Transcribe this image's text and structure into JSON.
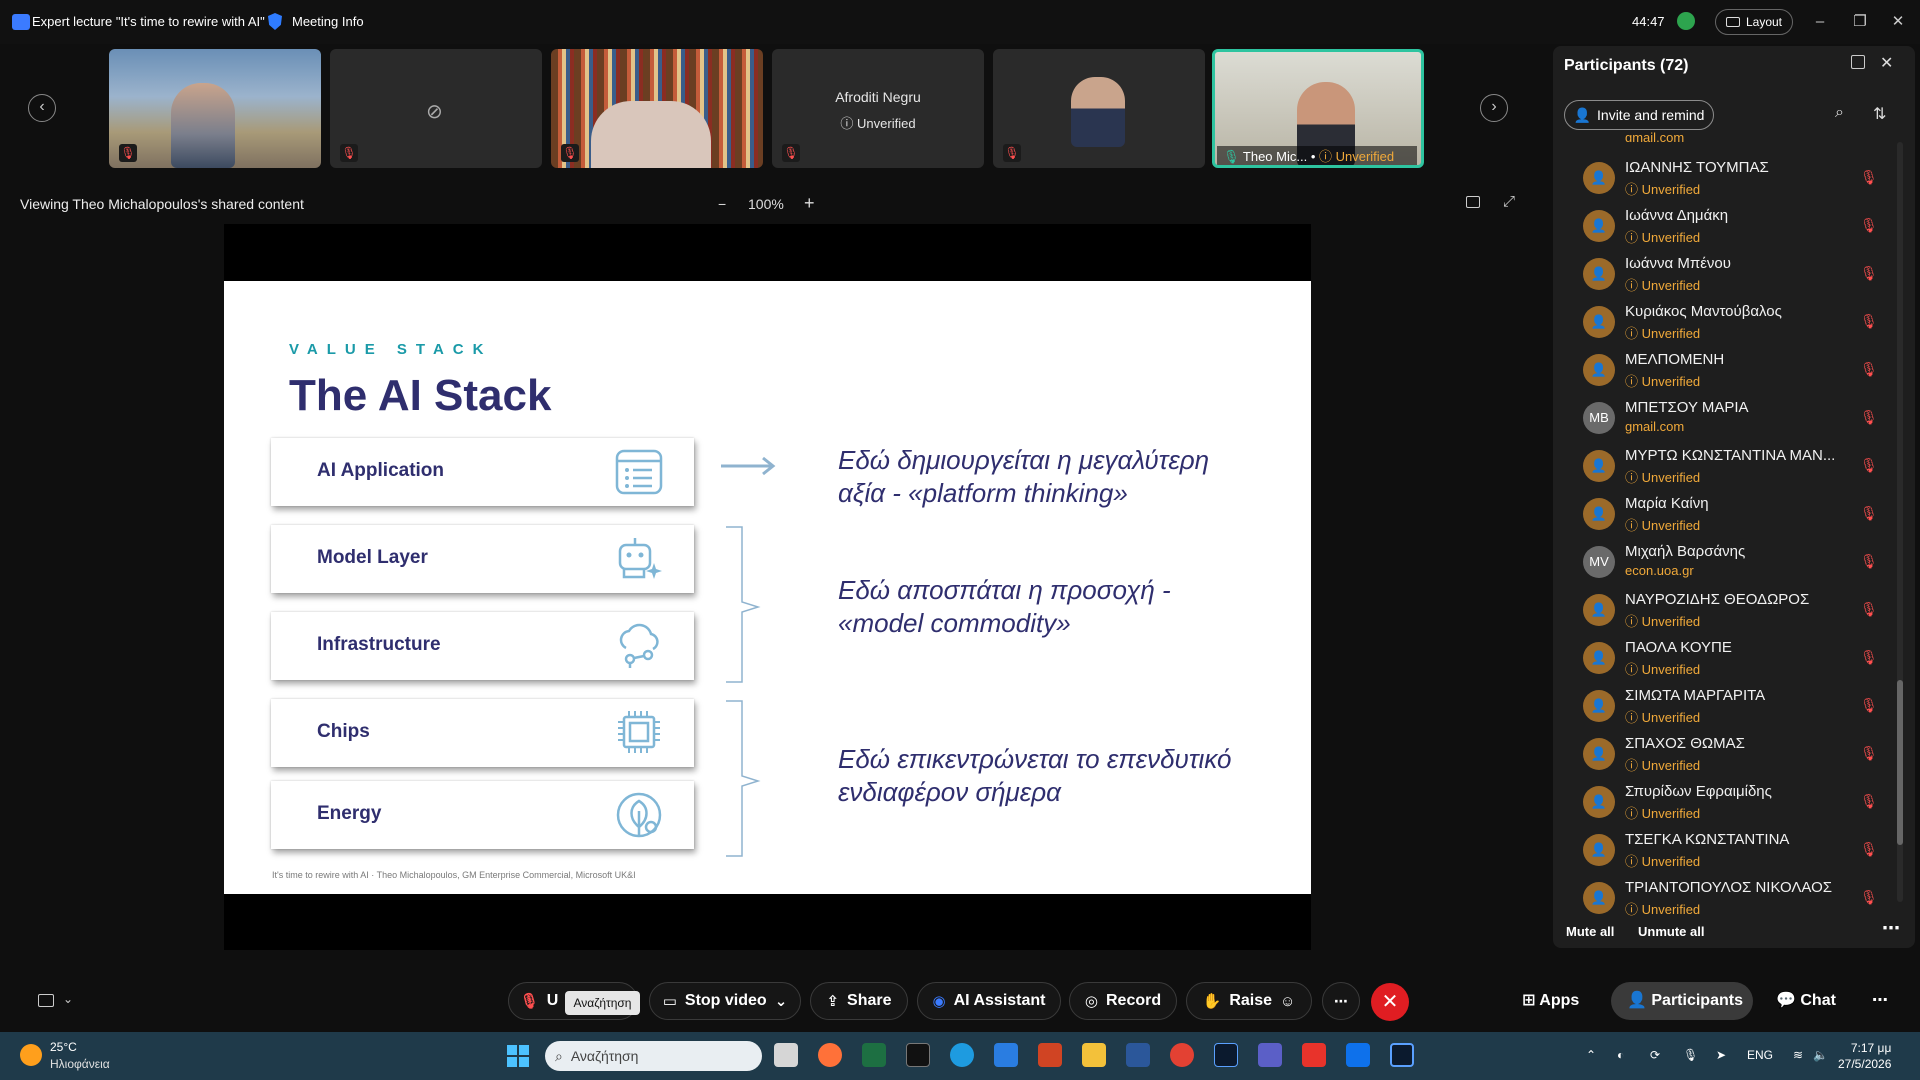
{
  "window": {
    "title": "Expert lecture \"It's time to rewire with AI\"",
    "meeting_info": "Meeting Info",
    "timer": "44:47",
    "layout_label": "Layout"
  },
  "thumbnails": [
    {
      "name": "",
      "status": ""
    },
    {
      "name": "",
      "status": ""
    },
    {
      "name": "",
      "status": ""
    },
    {
      "name": "Afroditi Negru",
      "status": "Unverified"
    },
    {
      "name": "",
      "status": ""
    },
    {
      "name": "Theo Mic...",
      "status": "Unverified"
    }
  ],
  "share": {
    "viewing": "Viewing Theo Michalopoulos's shared content",
    "zoom": "100%",
    "zoom_minus": "−",
    "zoom_plus": "+"
  },
  "slide": {
    "kicker": "VALUE STACK",
    "title": "The AI Stack",
    "layers": [
      "AI Application",
      "Model Layer",
      "Infrastructure",
      "Chips",
      "Energy"
    ],
    "statements": [
      "Εδώ δημιουργείται η μεγαλύτερη αξία - «platform thinking»",
      "Εδώ αποσπάται η προσοχή - «model commodity»",
      "Εδώ επικεντρώνεται το επενδυτικό ενδιαφέρον σήμερα"
    ],
    "footer": "It's time to rewire with AI  ·  Theo Michalopoulos, GM Enterprise Commercial, Microsoft UK&I"
  },
  "panel": {
    "title": "Participants (72)",
    "invite": "Invite and remind",
    "partial_top": "gmail.com",
    "participants": [
      {
        "initials": "",
        "name": "ΙΩΑΝΝΗΣ ΤΟΥΜΠΑΣ",
        "sub": "Unverified"
      },
      {
        "initials": "",
        "name": "Ιωάννα Δημάκη",
        "sub": "Unverified"
      },
      {
        "initials": "",
        "name": "Ιωάννα Μπένου",
        "sub": "Unverified"
      },
      {
        "initials": "",
        "name": "Κυριάκος Μαντούβαλος",
        "sub": "Unverified"
      },
      {
        "initials": "",
        "name": "ΜΕΛΠΟΜΕΝΗ",
        "sub": "Unverified"
      },
      {
        "initials": "MB",
        "name": "ΜΠΕΤΣΟΥ ΜΑΡΙΑ",
        "sub": "gmail.com"
      },
      {
        "initials": "",
        "name": "ΜΥΡΤΩ ΚΩΝΣΤΑΝΤΙΝΑ ΜΑΝ...",
        "sub": "Unverified"
      },
      {
        "initials": "",
        "name": "Μαρία Καίνη",
        "sub": "Unverified"
      },
      {
        "initials": "MV",
        "name": "Μιχαήλ Βαρσάνης",
        "sub": "econ.uoa.gr"
      },
      {
        "initials": "",
        "name": "ΝΑΥΡΟΖΙΔΗΣ ΘΕΟΔΩΡΟΣ",
        "sub": "Unverified"
      },
      {
        "initials": "",
        "name": "ΠΑΟΛΑ ΚΟΥΠΕ",
        "sub": "Unverified"
      },
      {
        "initials": "",
        "name": "ΣΙΜΩΤΑ ΜΑΡΓΑΡΙΤΑ",
        "sub": "Unverified"
      },
      {
        "initials": "",
        "name": "ΣΠΑΧΟΣ ΘΩΜΑΣ",
        "sub": "Unverified"
      },
      {
        "initials": "",
        "name": "Σπυρίδων Εφραιμίδης",
        "sub": "Unverified"
      },
      {
        "initials": "",
        "name": "ΤΣΕΓΚΑ ΚΩΝΣΤΑΝΤΙΝΑ",
        "sub": "Unverified"
      },
      {
        "initials": "",
        "name": "ΤΡΙΑΝΤΟΠΟΥΛΟΣ ΝΙΚΟΛΑΟΣ",
        "sub": "Unverified"
      }
    ],
    "mute_all": "Mute all",
    "unmute_all": "Unmute all"
  },
  "toolbar": {
    "unmute": "U",
    "tooltip": "Αναζήτηση",
    "stop_video": "Stop video",
    "share": "Share",
    "ai_assistant": "AI Assistant",
    "record": "Record",
    "raise": "Raise",
    "apps": "Apps",
    "participants": "Participants",
    "chat": "Chat"
  },
  "taskbar": {
    "temp": "25°C",
    "weather": "Ηλιοφάνεια",
    "search": "Αναζήτηση",
    "lang": "ENG",
    "time": "7:17 μμ",
    "date": "27/5/2026"
  },
  "colors": {
    "accent_teal": "#1a9aa8",
    "slide_navy": "#2f2e6e",
    "unverified": "#f0a93a",
    "end_red": "#e01d22",
    "mute_red": "#ff4f4f"
  }
}
